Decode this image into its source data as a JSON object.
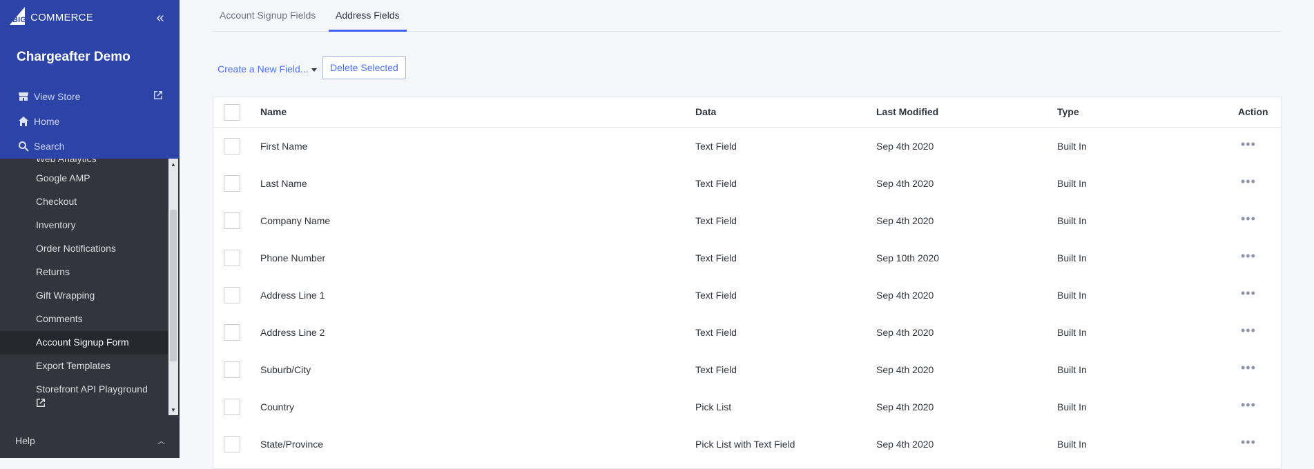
{
  "sidebar": {
    "logo_text": "COMMERCE",
    "logo_mark": "BIG",
    "store_name": "Chargeafter Demo",
    "top_links": [
      {
        "label": "View Store",
        "icon": "storefront-icon"
      },
      {
        "label": "Home",
        "icon": "home-icon"
      },
      {
        "label": "Search",
        "icon": "search-icon"
      }
    ],
    "partial_item": "Web Analytics",
    "items": [
      {
        "label": "Google AMP"
      },
      {
        "label": "Checkout"
      },
      {
        "label": "Inventory"
      },
      {
        "label": "Order Notifications"
      },
      {
        "label": "Returns"
      },
      {
        "label": "Gift Wrapping"
      },
      {
        "label": "Comments"
      },
      {
        "label": "Account Signup Form",
        "active": true
      },
      {
        "label": "Export Templates"
      },
      {
        "label": "Storefront API Playground"
      }
    ],
    "help_label": "Help",
    "colors": {
      "top": "#2c43a8",
      "menu": "#34343f",
      "active": "#26262f"
    }
  },
  "tabs": [
    {
      "label": "Account Signup Fields",
      "active": false
    },
    {
      "label": "Address Fields",
      "active": true
    }
  ],
  "toolbar": {
    "create_label": "Create a New Field...",
    "delete_label": "Delete Selected"
  },
  "table": {
    "headers": {
      "name": "Name",
      "data": "Data",
      "modified": "Last Modified",
      "type": "Type",
      "action": "Action"
    },
    "rows": [
      {
        "name": "First Name",
        "data": "Text Field",
        "modified": "Sep 4th 2020",
        "type": "Built In"
      },
      {
        "name": "Last Name",
        "data": "Text Field",
        "modified": "Sep 4th 2020",
        "type": "Built In"
      },
      {
        "name": "Company Name",
        "data": "Text Field",
        "modified": "Sep 4th 2020",
        "type": "Built In"
      },
      {
        "name": "Phone Number",
        "data": "Text Field",
        "modified": "Sep 10th 2020",
        "type": "Built In"
      },
      {
        "name": "Address Line 1",
        "data": "Text Field",
        "modified": "Sep 4th 2020",
        "type": "Built In"
      },
      {
        "name": "Address Line 2",
        "data": "Text Field",
        "modified": "Sep 4th 2020",
        "type": "Built In"
      },
      {
        "name": "Suburb/City",
        "data": "Text Field",
        "modified": "Sep 4th 2020",
        "type": "Built In"
      },
      {
        "name": "Country",
        "data": "Pick List",
        "modified": "Sep 4th 2020",
        "type": "Built In"
      },
      {
        "name": "State/Province",
        "data": "Pick List with Text Field",
        "modified": "Sep 4th 2020",
        "type": "Built In"
      }
    ]
  }
}
